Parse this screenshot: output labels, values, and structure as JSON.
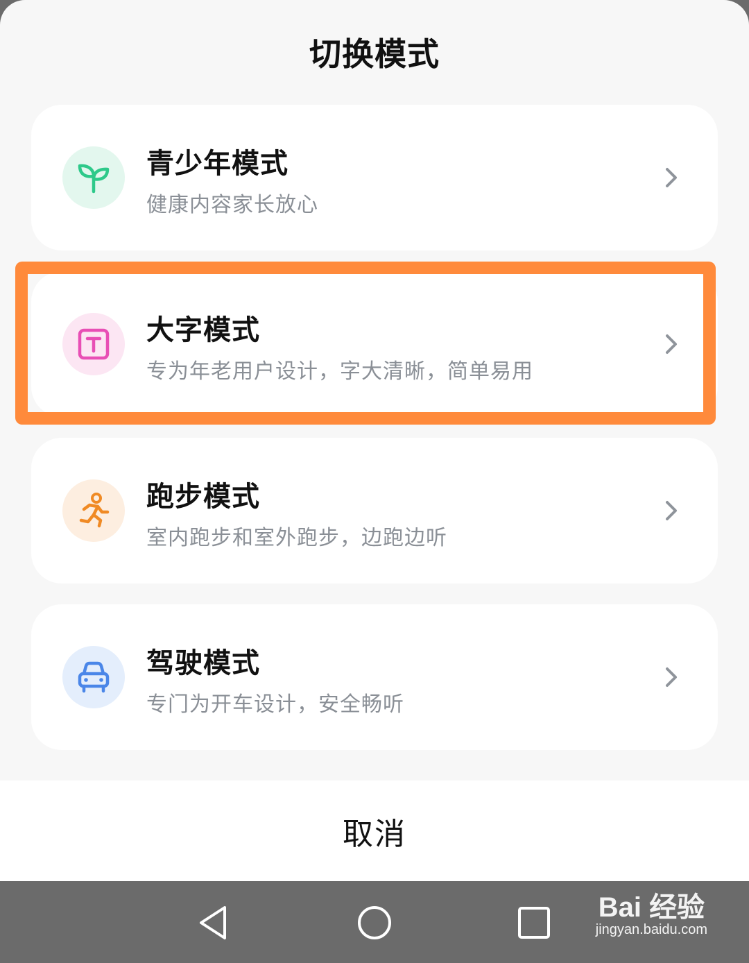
{
  "sheet": {
    "title": "切换模式"
  },
  "modes": [
    {
      "title": "青少年模式",
      "description": "健康内容家长放心",
      "icon": "sprout-icon",
      "icon_color": "#2ec98a",
      "icon_bg": "#e3f7ee"
    },
    {
      "title": "大字模式",
      "description": "专为年老用户设计，字大清晰，简单易用",
      "icon": "text-t-icon",
      "icon_color": "#e84fb5",
      "icon_bg": "#fce6f3"
    },
    {
      "title": "跑步模式",
      "description": "室内跑步和室外跑步，边跑边听",
      "icon": "running-icon",
      "icon_color": "#f08a24",
      "icon_bg": "#fdeee0"
    },
    {
      "title": "驾驶模式",
      "description": "专门为开车设计，安全畅听",
      "icon": "car-icon",
      "icon_color": "#4a86e8",
      "icon_bg": "#e4eefc"
    }
  ],
  "highlight_color": "#ff8a3b",
  "cancel_label": "取消",
  "navbar": {
    "back": "back-triangle-icon",
    "home": "home-circle-icon",
    "recents": "recents-square-icon"
  },
  "watermark": {
    "brand": "Bai 经验",
    "url": "jingyan.baidu.com"
  }
}
